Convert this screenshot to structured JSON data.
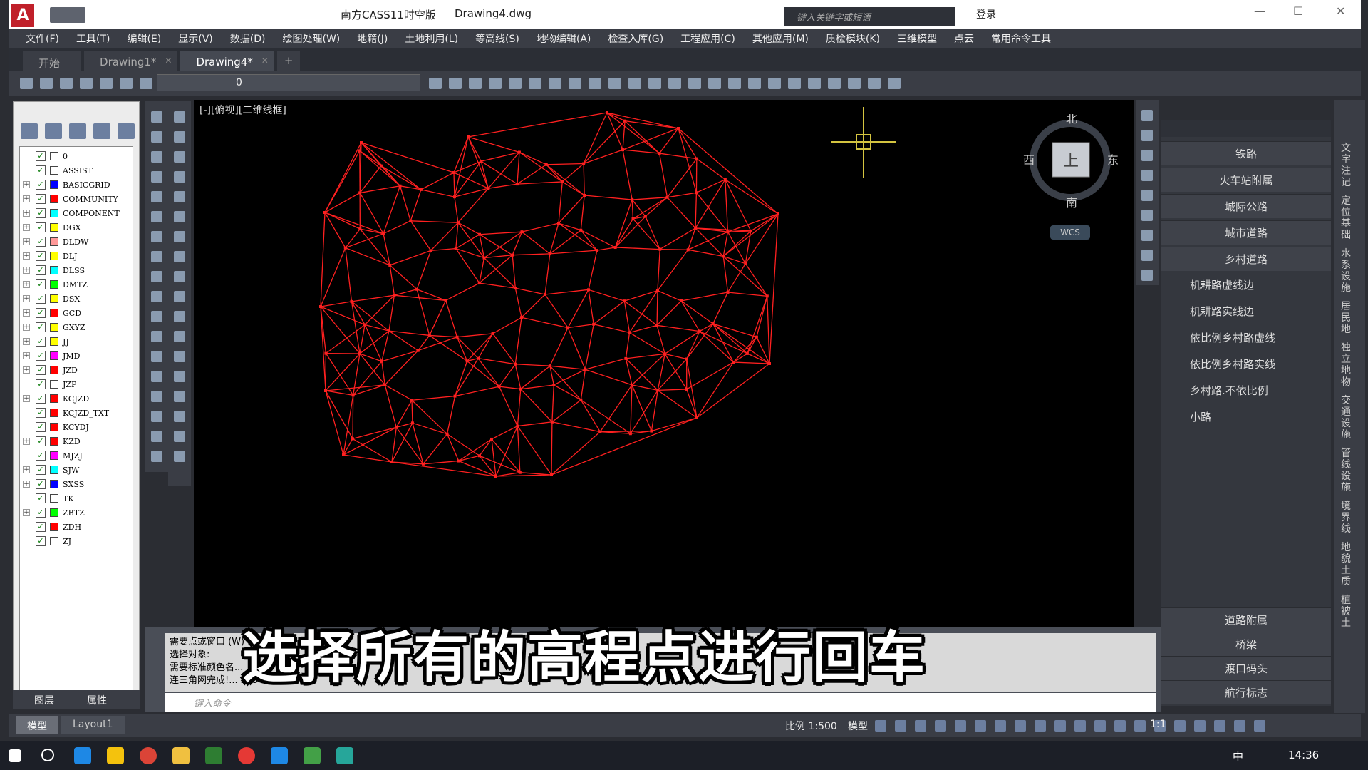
{
  "title_bar": {
    "app_name": "南方CASS11时空版",
    "file_name": "Drawing4.dwg",
    "search_placeholder": "键入关键字或短语",
    "login_label": "登录"
  },
  "menu": [
    "文件(F)",
    "工具(T)",
    "编辑(E)",
    "显示(V)",
    "数据(D)",
    "绘图处理(W)",
    "地籍(J)",
    "土地利用(L)",
    "等高线(S)",
    "地物编辑(A)",
    "检查入库(G)",
    "工程应用(C)",
    "其他应用(M)",
    "质检模块(K)",
    "三维模型",
    "点云",
    "常用命令工具"
  ],
  "tabs": [
    {
      "label": "开始",
      "active": false
    },
    {
      "label": "Drawing1*",
      "active": false
    },
    {
      "label": "Drawing4*",
      "active": true
    }
  ],
  "toolbar": {
    "layer_value": "0"
  },
  "layers": [
    "0",
    "ASSIST",
    "BASICGRID",
    "COMMUNITY",
    "COMPONENT",
    "DGX",
    "DLDW",
    "DLJ",
    "DLSS",
    "DMTZ",
    "DSX",
    "GCD",
    "GXYZ",
    "JJ",
    "JMD",
    "JZD",
    "JZP",
    "KCJZD",
    "KCJZD_TXT",
    "KCYDJ",
    "KZD",
    "MJZJ",
    "SJW",
    "SXSS",
    "TK",
    "ZBTZ",
    "ZDH",
    "ZJ"
  ],
  "layer_colors": [
    "#ffffff",
    "#ffffff",
    "#0000ff",
    "#ff0000",
    "#00ffff",
    "#ffff00",
    "#ff9999",
    "#ffff00",
    "#00ffff",
    "#00ff00",
    "#ffff00",
    "#ff0000",
    "#ffff00",
    "#ffff00",
    "#ff00ff",
    "#ff0000",
    "#ffffff",
    "#ff0000",
    "#ff0000",
    "#ff0000",
    "#ff0000",
    "#ff00ff",
    "#00ffff",
    "#0000ff",
    "#ffffff",
    "#00ff00",
    "#ff0000",
    "#ffffff"
  ],
  "layer_expandable": [
    false,
    false,
    true,
    true,
    true,
    true,
    true,
    true,
    true,
    true,
    true,
    true,
    true,
    true,
    true,
    true,
    false,
    true,
    false,
    false,
    true,
    false,
    true,
    true,
    false,
    true,
    false,
    false
  ],
  "panel_tabs": {
    "layers": "图层",
    "properties": "属性"
  },
  "viewport": {
    "label": "[-][俯视][二维线框]"
  },
  "viewcube": {
    "north": "北",
    "south": "南",
    "east": "东",
    "west": "西",
    "top": "上",
    "wcs": "WCS"
  },
  "right_panel": {
    "items": [
      {
        "label": "铁路",
        "style": "center"
      },
      {
        "label": "火车站附属",
        "style": "center"
      },
      {
        "label": "城际公路",
        "style": "center"
      },
      {
        "label": "城市道路",
        "style": "center"
      },
      {
        "label": "乡村道路",
        "style": "center"
      },
      {
        "label": "机耕路虚线边",
        "style": "left"
      },
      {
        "label": "机耕路实线边",
        "style": "left"
      },
      {
        "label": "依比例乡村路虚线",
        "style": "left"
      },
      {
        "label": "依比例乡村路实线",
        "style": "left"
      },
      {
        "label": "乡村路.不依比例",
        "style": "left"
      },
      {
        "label": "小路",
        "style": "left"
      }
    ],
    "bottom_items": [
      "道路附属",
      "桥梁",
      "渡口码头",
      "航行标志"
    ]
  },
  "vertical_tabs": [
    "文字注记",
    "定位基础",
    "水系设施",
    "居民地",
    "独立地物",
    "交通设施",
    "管线设施",
    "境界线",
    "地貌土质",
    "植被土"
  ],
  "command": {
    "lines": [
      "需要点或窗口 (W) ...",
      "选择对象:",
      "需要标准颜色名...",
      "连三角网完成!... 235 ... 角形"
    ],
    "input_placeholder": "键入命令"
  },
  "subtitle": "选择所有的高程点进行回车",
  "layout_tabs": [
    {
      "label": "模型",
      "active": true
    },
    {
      "label": "Layout1",
      "active": false
    }
  ],
  "status": {
    "scale": "比例 1:500",
    "model": "模型",
    "zoom": "1:1"
  },
  "taskbar": {
    "time": "14:36",
    "ime": "中"
  },
  "colors": {
    "tin": "#ff2020",
    "canvas": "#000000",
    "accent": "#c0202a"
  }
}
